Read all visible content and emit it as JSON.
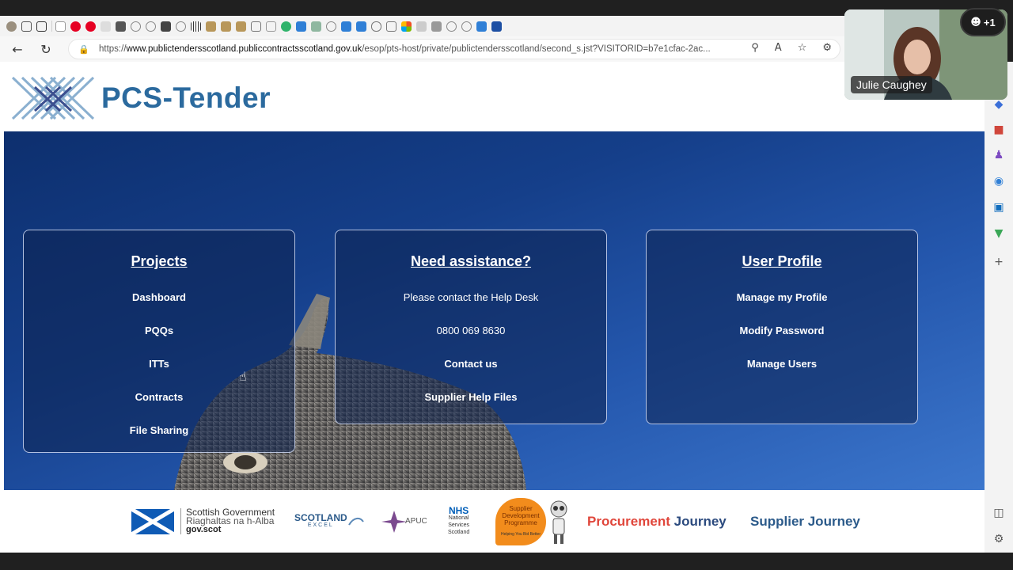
{
  "browser": {
    "url_prefix": "https://",
    "url_host": "www.publictendersscotland.publiccontractsscotland.gov.uk",
    "url_path": "/esop/pts-host/private/publictendersscotland/second_s.jst?VISITORID=b7e1cfac-2ac...",
    "back_icon": "back-arrow-icon",
    "reload_icon": "reload-icon"
  },
  "brand": {
    "name": "PCS-Tender"
  },
  "cards": {
    "projects": {
      "title": "Projects",
      "items": [
        "Dashboard",
        "PQQs",
        "ITTs",
        "Contracts",
        "File Sharing"
      ]
    },
    "assistance": {
      "title": "Need assistance?",
      "line1": "Please contact the Help Desk",
      "phone": "0800 069 8630",
      "contact": "Contact us",
      "help_files": "Supplier Help Files"
    },
    "profile": {
      "title": "User Profile",
      "items": [
        "Manage my Profile",
        "Modify Password",
        "Manage Users"
      ]
    }
  },
  "footer": {
    "scot_gov_line1": "Scottish Government",
    "scot_gov_line2": "Riaghaltas na h-Alba",
    "scot_gov_line3": "gov.scot",
    "scotland_excel_line1": "SCOTLAND",
    "scotland_excel_line2": "EXCEL",
    "apuc": "APUC",
    "nhs_line1": "NHS",
    "nhs_line2": "National",
    "nhs_line3": "Services",
    "nhs_line4": "Scotland",
    "sdp_line1": "Supplier",
    "sdp_line2": "Development",
    "sdp_line3": "Programme",
    "sdp_tagline": "Helping You Bid Better",
    "procurement_pro": "Pro",
    "procurement_cur": "curement",
    "procurement_journey": "Journey",
    "supplier_journey": "Supplier Journey"
  },
  "call": {
    "participant_name": "Julie Caughey",
    "participant_count": "+1"
  },
  "colors": {
    "brand_blue": "#2b6a9e",
    "hero_dark": "#0d2f6e",
    "procurement_red": "#e0463b"
  }
}
